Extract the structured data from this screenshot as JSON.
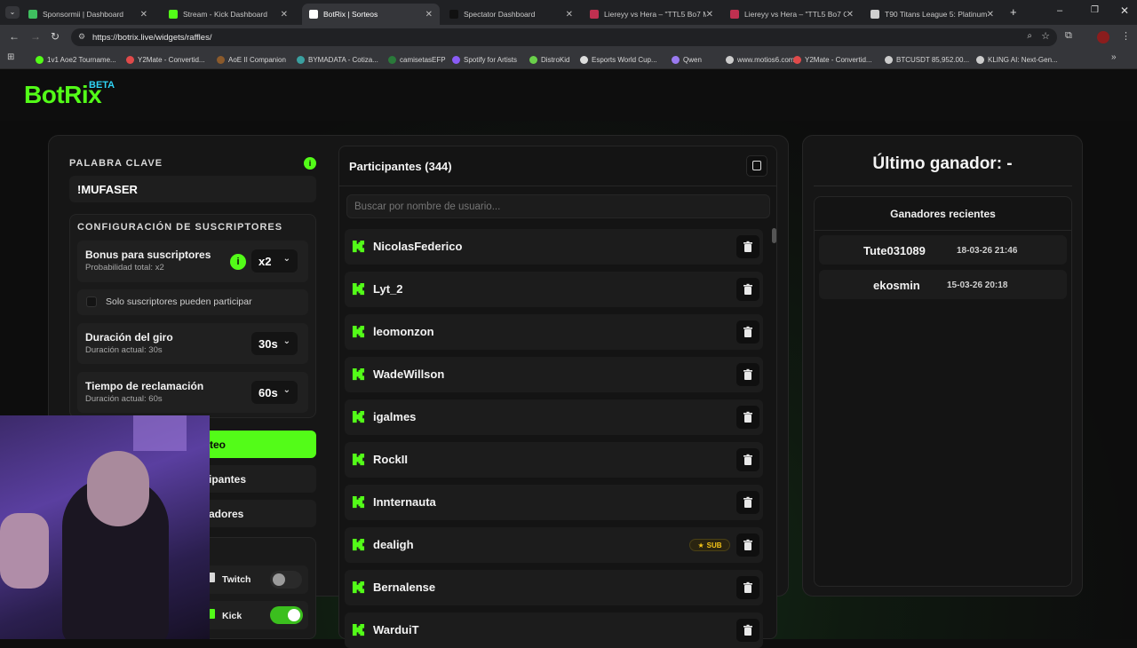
{
  "browser": {
    "tabs": [
      {
        "label": "Sponsormii | Dashboard",
        "color": "#3fbf5f"
      },
      {
        "label": "Stream - Kick Dashboard",
        "color": "#53fc18"
      },
      {
        "label": "BotRix | Sorteos",
        "color": "#ffffff"
      },
      {
        "label": "Spectator Dashboard",
        "color": "#111111"
      },
      {
        "label": "Liereyy vs Hera – \"TTL5 Bo7 Ma",
        "color": "#c03050"
      },
      {
        "label": "Liereyy vs Hera – \"TTL5 Bo7 Civ",
        "color": "#c03050"
      },
      {
        "label": "T90 Titans League 5: Platinum",
        "color": "#cfcfcf"
      }
    ],
    "url": "https://botrix.live/widgets/raffles/",
    "bookmarks": [
      "1v1 Aoe2 Tourname...",
      "Y2Mate - Convertid...",
      "AoE II Companion",
      "BYMADATA - Cotiza...",
      "camisetasEFP",
      "Spotify for Artists",
      "DistroKid",
      "Esports World Cup...",
      "Qwen",
      "www.motios6.com",
      "Y2Mate - Convertid...",
      "BTCUSDT 85,952.00...",
      "KLING AI: Next-Gen..."
    ]
  },
  "brand": {
    "name": "BotRix",
    "beta": "BETA",
    "accent": "#53fc18"
  },
  "settings": {
    "keyword_label": "PALABRA CLAVE",
    "keyword_value": "!MUFASER",
    "subs_config_title": "CONFIGURACIÓN DE SUSCRIPTORES",
    "bonus_title": "Bonus para suscriptores",
    "bonus_sub": "Probabilidad total: x2",
    "bonus_value": "x2",
    "subs_only_label": "Solo suscriptores pueden participar",
    "spin_title": "Duración del giro",
    "spin_sub": "Duración actual: 30s",
    "spin_value": "30s",
    "claim_title": "Tiempo de reclamación",
    "claim_sub": "Duración actual: 60s",
    "claim_value": "60s",
    "btn_start_partial": "teo",
    "btn_participants_partial": "ipantes",
    "btn_winners_partial": "adores",
    "twitch_label": "Twitch",
    "kick_label": "Kick"
  },
  "participants": {
    "title": "Participantes (344)",
    "search_placeholder": "Buscar por nombre de usuario...",
    "sub_badge": "SUB",
    "list": [
      {
        "name": "NicolasFederico",
        "sub": false
      },
      {
        "name": "Lyt_2",
        "sub": false
      },
      {
        "name": "leomonzon",
        "sub": false
      },
      {
        "name": "WadeWillson",
        "sub": false
      },
      {
        "name": "igalmes",
        "sub": false
      },
      {
        "name": "RockII",
        "sub": false
      },
      {
        "name": "Innternauta",
        "sub": false
      },
      {
        "name": "dealigh",
        "sub": true
      },
      {
        "name": "Bernalense",
        "sub": false
      },
      {
        "name": "WarduiT",
        "sub": false
      }
    ]
  },
  "winner": {
    "title": "Último ganador: -",
    "recent_title": "Ganadores recientes",
    "recent": [
      {
        "name": "Tute031089",
        "date": "18-03-26 21:46"
      },
      {
        "name": "ekosmin",
        "date": "15-03-26 20:18"
      }
    ]
  }
}
